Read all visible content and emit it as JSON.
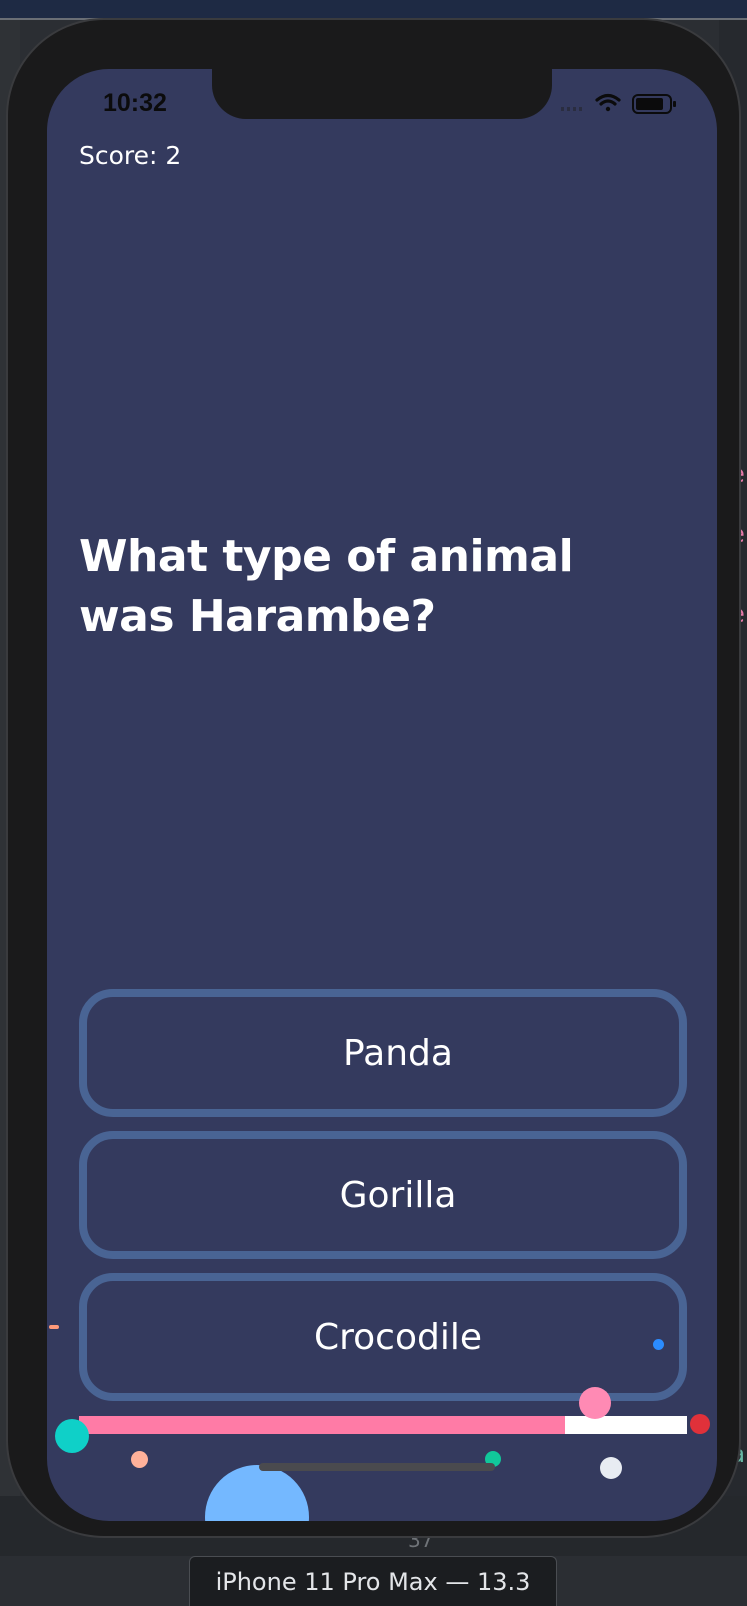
{
  "status_bar": {
    "time": "10:32"
  },
  "quiz": {
    "score_label": "Score: 2",
    "question": "What type of animal was Harambe?",
    "answers": [
      {
        "label": "Panda"
      },
      {
        "label": "Gorilla"
      },
      {
        "label": "Crocodile"
      }
    ],
    "progress": 0.8
  },
  "simulator": {
    "device_label": "iPhone 11 Pro Max — 13.3",
    "line_number": "37"
  },
  "icons": {
    "signal": "cellular-signal-icon",
    "wifi": "wifi-icon",
    "battery": "battery-icon"
  },
  "colors": {
    "background": "#343a5e",
    "answer_border": "#496494",
    "progress_fill": "#ff7ba6",
    "progress_track": "#ffffff"
  }
}
